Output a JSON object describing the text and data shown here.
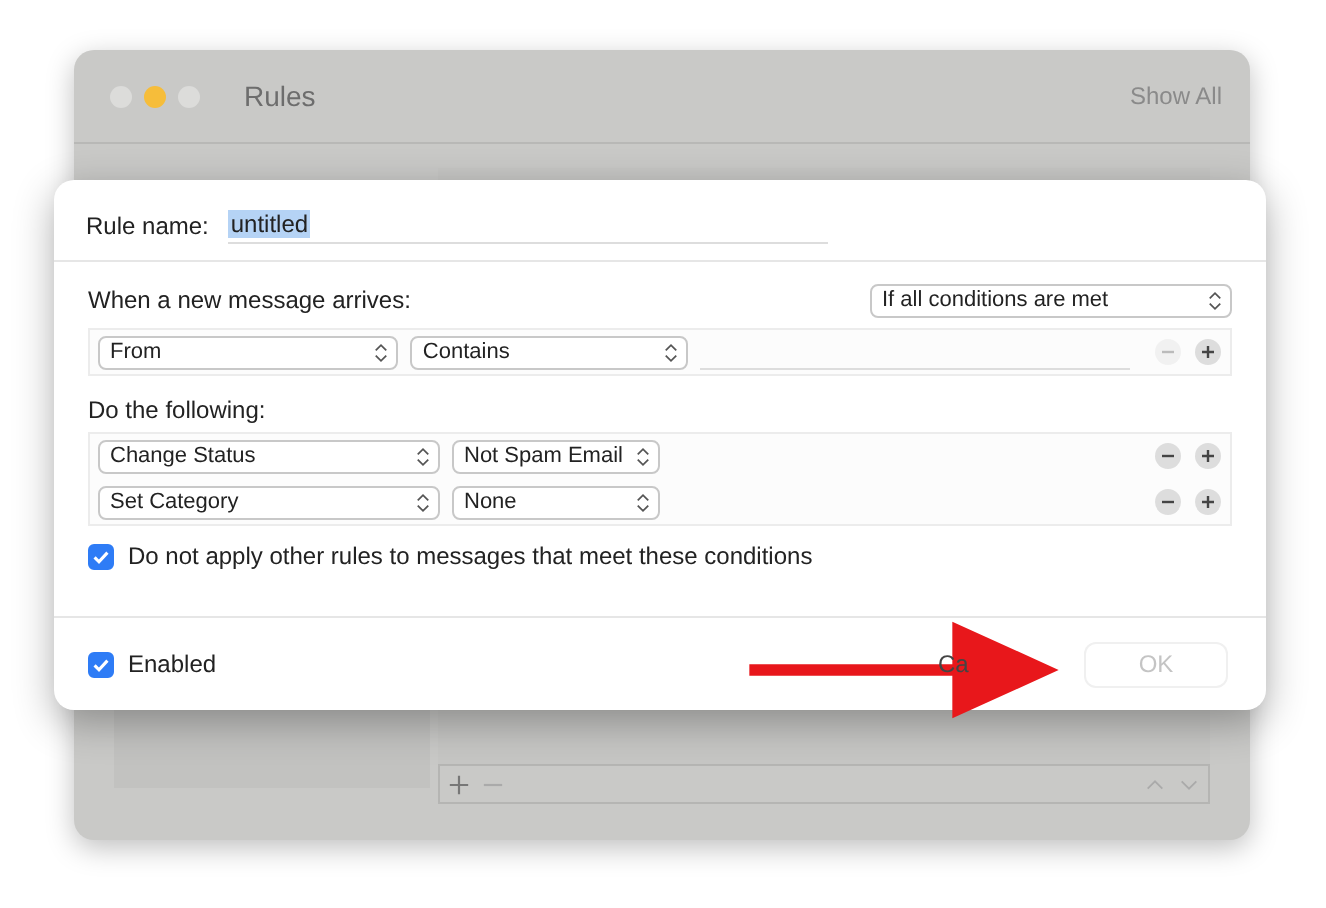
{
  "window": {
    "title": "Rules",
    "show_all": "Show All"
  },
  "dialog": {
    "rule_name": {
      "label": "Rule name:",
      "value": "untitled"
    },
    "conditions": {
      "label": "When a new message arrives:",
      "match": "If all conditions are met",
      "rows": [
        {
          "field": "From",
          "operator": "Contains",
          "can_remove": false
        }
      ]
    },
    "actions": {
      "label": "Do the following:",
      "rows": [
        {
          "action": "Change Status",
          "value": "Not Spam Email",
          "can_remove": true
        },
        {
          "action": "Set Category",
          "value": "None",
          "can_remove": true
        }
      ]
    },
    "stop_rules": {
      "label": "Do not apply other rules to messages that meet these conditions",
      "checked": true
    },
    "enabled": {
      "label": "Enabled",
      "checked": true
    },
    "buttons": [
      {
        "kind": "cancel",
        "label": "Ca",
        "disabled": false
      },
      {
        "kind": "ok",
        "label": "OK",
        "disabled": true
      }
    ]
  }
}
